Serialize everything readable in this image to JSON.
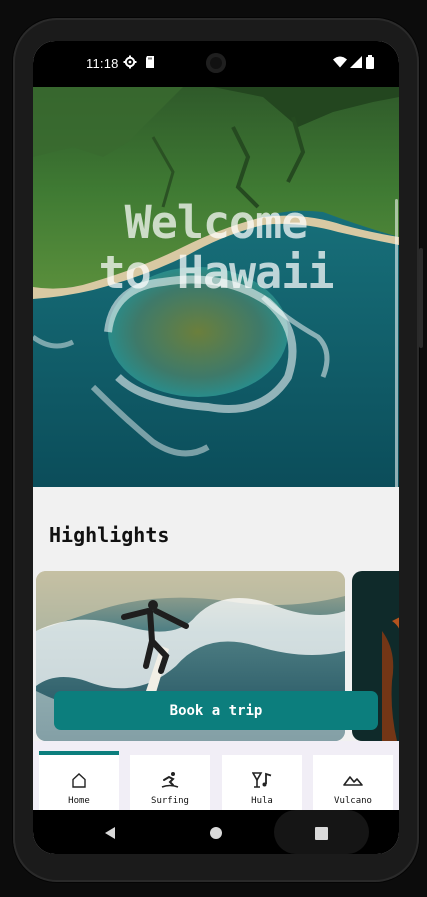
{
  "status_bar": {
    "time": "11:18",
    "icons": [
      "gear-icon",
      "sd-card-icon",
      "wifi-icon",
      "signal-icon",
      "battery-icon"
    ]
  },
  "hero": {
    "title_line1": "Welcome",
    "title_line2": "to Hawaii"
  },
  "highlights": {
    "title": "Highlights",
    "cards": [
      {
        "image": "surfer-on-wave"
      },
      {
        "image": "hula-dancer"
      }
    ]
  },
  "book_button": {
    "label": "Book a trip"
  },
  "bottom_nav": {
    "tabs": [
      {
        "label": "Home",
        "icon": "home-icon",
        "active": true
      },
      {
        "label": "Surfing",
        "icon": "surfing-icon",
        "active": false
      },
      {
        "label": "Hula",
        "icon": "hula-music-icon",
        "active": false
      },
      {
        "label": "Vulcano",
        "icon": "mountain-icon",
        "active": false
      }
    ]
  },
  "system_nav": {
    "buttons": [
      "back-icon",
      "home-circle-icon",
      "recents-icon"
    ]
  },
  "colors": {
    "accent": "#0c7e7d",
    "nav_background": "#f1eef6",
    "page_background": "#f1f1f1"
  }
}
